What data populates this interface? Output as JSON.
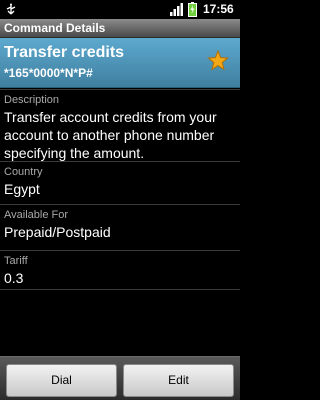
{
  "status_bar": {
    "time": "17:56",
    "icons": [
      "usb-icon",
      "signal-icon",
      "battery-charging-icon"
    ]
  },
  "title_bar": {
    "title": "Command Details"
  },
  "header": {
    "title": "Transfer credits",
    "code": "*165*0000*N*P#",
    "favorite_icon": "star-icon",
    "star_color": "#f3a915"
  },
  "fields": [
    {
      "label": "Description",
      "value": "Transfer account credits from your account to another phone number specifying the amount."
    },
    {
      "label": "Country",
      "value": "Egypt"
    },
    {
      "label": "Available For",
      "value": "Prepaid/Postpaid"
    },
    {
      "label": "Tariff",
      "value": "0.3"
    }
  ],
  "buttons": {
    "dial": "Dial",
    "edit": "Edit"
  },
  "colors": {
    "header": "#4b93b8",
    "background": "#000000"
  }
}
